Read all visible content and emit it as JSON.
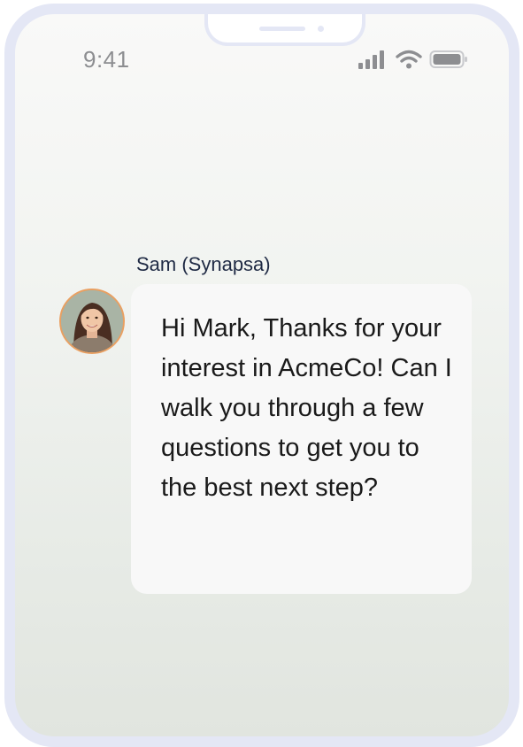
{
  "status_bar": {
    "time": "9:41",
    "icons": [
      "signal-icon",
      "wifi-icon",
      "battery-icon"
    ]
  },
  "chat": {
    "sender_name": "Sam (Synapsa)",
    "avatar_icon": "woman-portrait-avatar",
    "message": "Hi Mark, Thanks for your interest in AcmeCo! Can I walk you through a few questions to get you to the best next step?"
  },
  "colors": {
    "frame_border": "#e4e7f5",
    "bubble_bg": "#f8f8f8",
    "sender_name": "#1f2a44",
    "avatar_ring": "#e9a062"
  }
}
